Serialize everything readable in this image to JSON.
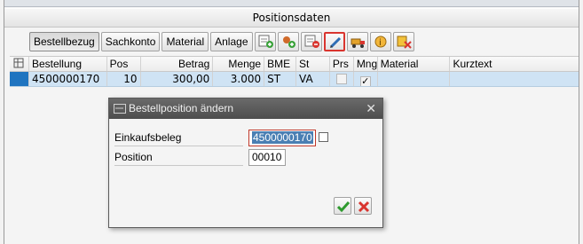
{
  "panel": {
    "title": "Positionsdaten"
  },
  "toolbar": {
    "tabs": [
      "Bestellbezug",
      "Sachkonto",
      "Material",
      "Anlage"
    ],
    "icons": [
      "add-row-icon",
      "insert-row-icon",
      "delete-row-icon",
      "edit-pencil-icon",
      "transport-icon",
      "info-search-icon",
      "remove-item-icon"
    ]
  },
  "grid": {
    "headers": [
      "Bestellung",
      "Pos",
      "Betrag",
      "Menge",
      "BME",
      "St",
      "Prs",
      "Mng",
      "Material",
      "Kurztext"
    ],
    "rows": [
      {
        "bestellung": "4500000170",
        "pos": "10",
        "betrag": "300,00",
        "menge": "3.000",
        "bme": "ST",
        "st": "VA",
        "prs": "",
        "mng": "✓",
        "material": "",
        "kurztext": ""
      }
    ]
  },
  "dialog": {
    "title": "Bestellposition ändern",
    "fields": [
      {
        "label": "Einkaufsbeleg",
        "value": "4500000170"
      },
      {
        "label": "Position",
        "value": "00010"
      }
    ],
    "close": "✕"
  },
  "colors": {
    "selection": "#cfe3f4",
    "row_marker": "#1f74c0",
    "accept": "#2e9a2e",
    "cancel": "#d9352f"
  }
}
